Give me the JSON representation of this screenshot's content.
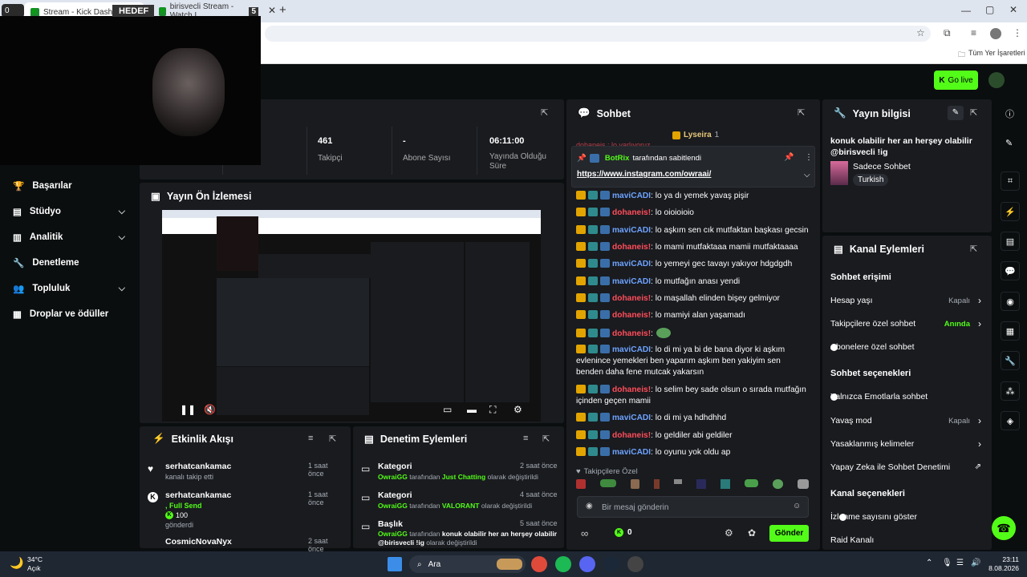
{
  "browser": {
    "tabs": [
      {
        "label": "Stream - Kick Dashboard",
        "prefix": "0"
      },
      {
        "label": "HEDEF"
      },
      {
        "label": "birisvecli Stream - Watch L",
        "suffix": "5"
      }
    ],
    "new_tab": "+",
    "bookmarks": "Tüm Yer İşaretleri"
  },
  "header": {
    "go_live": "Go live"
  },
  "sidebar": {
    "items": [
      {
        "label": "Başarılar",
        "chevron": false
      },
      {
        "label": "Stüdyo",
        "chevron": true
      },
      {
        "label": "Analitik",
        "chevron": true
      },
      {
        "label": "Denetleme",
        "chevron": false
      },
      {
        "label": "Topluluk",
        "chevron": true
      },
      {
        "label": "Droplar ve ödüller",
        "chevron": false
      }
    ]
  },
  "stats": [
    {
      "value": "461",
      "label": "Takipçi"
    },
    {
      "value": "-",
      "label": "Abone Sayısı"
    },
    {
      "value": "06:11:00",
      "label": "Yayında Olduğu Süre"
    }
  ],
  "preview": {
    "title": "Yayın Ön İzlemesi"
  },
  "activity": {
    "title": "Etkinlik Akışı",
    "items": [
      {
        "user": "serhatcankamac",
        "time": "1 saat önce",
        "lines": [
          "kanalı takip etti"
        ]
      },
      {
        "user": "serhatcankamac",
        "time": "1 saat önce",
        "lines": [
          ", Full Send",
          "100",
          "gönderdi"
        ]
      },
      {
        "user": "CosmicNovaNyx",
        "time": "2 saat önce",
        "lines": []
      }
    ]
  },
  "moderation": {
    "title": "Denetim Eylemleri",
    "items": [
      {
        "kind": "Kategori",
        "time": "2 saat önce",
        "actor": "OwraiGG",
        "mid": "tarafından",
        "value": "Just Chatting",
        "tail": "olarak değiştirildi"
      },
      {
        "kind": "Kategori",
        "time": "4 saat önce",
        "actor": "OwraiGG",
        "mid": "tarafından",
        "value": "VALORANT",
        "tail": "olarak değiştirildi"
      },
      {
        "kind": "Başlık",
        "time": "5 saat önce",
        "actor": "OwraiGG",
        "mid": "tarafından",
        "value": "konuk olabilir her an herşey olabilir @birisvecli !ig",
        "tail": "olarak değiştirildi"
      }
    ]
  },
  "chat": {
    "title": "Sohbet",
    "top_user": "Lyseira",
    "top_count": "1",
    "hidden_line": "dohaneis : lo varlıyoruz..",
    "pinned_by": "BotRix",
    "pinned_suffix": "tarafından sabitlendi",
    "pinned_link": "https://www.instagram.com/owraai/",
    "messages": [
      {
        "badge": "crown",
        "user": "maviCADI",
        "color": "m",
        "text": ": lo ya dı yemek yavaş pişir"
      },
      {
        "badge": "16",
        "user": "dohaneis!",
        "color": "d",
        "text": ": lo oioioioio"
      },
      {
        "badge": "crown",
        "user": "maviCADI",
        "color": "m",
        "text": ": lo aşkım sen cık mutfaktan başkası gecsin"
      },
      {
        "badge": "16",
        "user": "dohaneis!",
        "color": "d",
        "text": ": lo mami mutfaktaaa mamii mutfaktaaaa"
      },
      {
        "badge": "crown",
        "user": "maviCADI",
        "color": "m",
        "text": ": lo yemeyi gec tavayı yakıyor hdgdgdh"
      },
      {
        "badge": "crown",
        "user": "maviCADI",
        "color": "m",
        "text": ": lo mutfağın anası yendi"
      },
      {
        "badge": "16",
        "user": "dohaneis!",
        "color": "d",
        "text": ": lo maşallah elinden bişey gelmiyor"
      },
      {
        "badge": "16",
        "user": "dohaneis!",
        "color": "d",
        "text": ": lo mamiyi alan yaşamadı"
      },
      {
        "badge": "16",
        "user": "dohaneis!",
        "color": "d",
        "text": ":"
      },
      {
        "badge": "crown",
        "user": "maviCADI",
        "color": "m",
        "text": ": lo di mi ya bi de bana diyor ki aşkım evlenince yemekleri ben yaparım aşkım ben yakiyim sen benden daha fene mutcak yakarsın"
      },
      {
        "badge": "16",
        "user": "dohaneis!",
        "color": "d",
        "text": ": lo selim bey sade olsun o sırada mutfağın içinden geçen mamii"
      },
      {
        "badge": "crown",
        "user": "maviCADI",
        "color": "m",
        "text": ": lo di mi ya hdhdhhd"
      },
      {
        "badge": "16",
        "user": "dohaneis!",
        "color": "d",
        "text": ": lo geldiler abi geldiler"
      },
      {
        "badge": "crown",
        "user": "maviCADI",
        "color": "m",
        "text": ": lo oyunu yok oldu ap"
      }
    ],
    "followers_only": "Takipçilere Özel",
    "input_placeholder": "Bir mesaj gönderin",
    "points": "0",
    "send": "Gönder"
  },
  "stream_info": {
    "title": "Yayın bilgisi",
    "stream_title": "konuk olabilir her an herşey olabilir @birisvecli !ig",
    "category": "Sadece Sohbet",
    "tag": "Turkish"
  },
  "channel_actions": {
    "title": "Kanal Eylemleri",
    "chat_access": "Sohbet erişimi",
    "rows1": [
      {
        "label": "Hesap yaşı",
        "value": "Kapalı",
        "type": "nav"
      },
      {
        "label": "Takipçilere özel sohbet",
        "value": "Anında",
        "type": "nav-green"
      },
      {
        "label": "Abonelere özel sohbet",
        "value": "",
        "type": "toggle-off"
      }
    ],
    "chat_options": "Sohbet seçenekleri",
    "rows2": [
      {
        "label": "Yalnızca Emotlarla sohbet",
        "value": "",
        "type": "toggle-off"
      },
      {
        "label": "Yavaş mod",
        "value": "Kapalı",
        "type": "nav"
      },
      {
        "label": "Yasaklanmış kelimeler",
        "value": "",
        "type": "nav"
      },
      {
        "label": "Yapay Zeka ile Sohbet Denetimi",
        "value": "",
        "type": "ext"
      }
    ],
    "channel_options": "Kanal seçenekleri",
    "rows3": [
      {
        "label": "İzlenme sayısını göster",
        "value": "",
        "type": "toggle-on"
      },
      {
        "label": "Raid Kanalı",
        "value": "",
        "type": "none"
      }
    ]
  },
  "taskbar": {
    "temp": "34°C",
    "weather": "Açık",
    "search": "Ara",
    "time": "23:11",
    "date": "8.08.2026"
  }
}
